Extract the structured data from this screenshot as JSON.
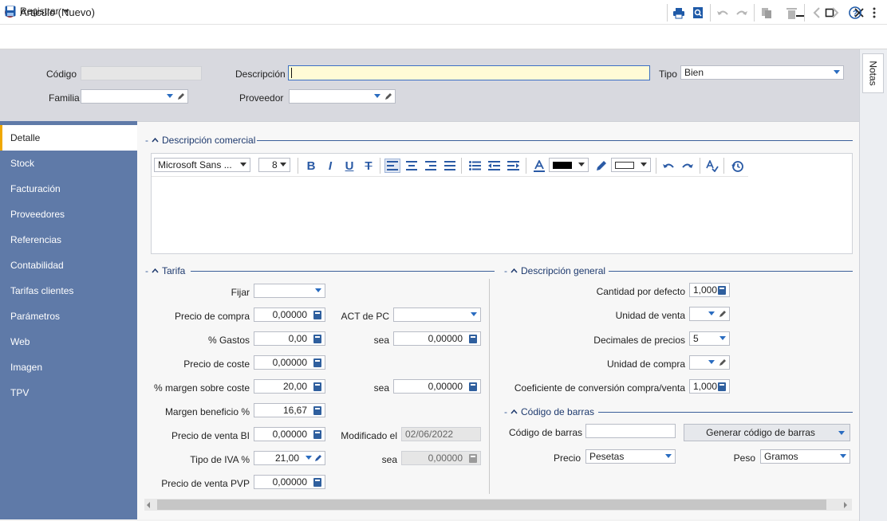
{
  "window": {
    "title": "Artículo (Nuevo)"
  },
  "toolbar": {
    "register_label": "Registrar"
  },
  "header": {
    "codigo_label": "Código",
    "codigo_value": "",
    "descripcion_label": "Descripción",
    "descripcion_value": "",
    "tipo_label": "Tipo",
    "tipo_value": "Bien",
    "familia_label": "Familia",
    "familia_value": "",
    "proveedor_label": "Proveedor",
    "proveedor_value": ""
  },
  "notes_tab": "Notas",
  "nav": {
    "items": [
      "Detalle",
      "Stock",
      "Facturación",
      "Proveedores",
      "Referencias",
      "Contabilidad",
      "Tarifas clientes",
      "Parámetros",
      "Web",
      "Imagen",
      "TPV"
    ]
  },
  "commercial": {
    "title": "Descripción comercial",
    "font_name": "Microsoft Sans ...",
    "font_size": "8"
  },
  "tarifa": {
    "title": "Tarifa",
    "fijar_label": "Fijar",
    "fijar_value": "",
    "precio_compra_label": "Precio de compra",
    "precio_compra_value": "0,00000",
    "gastos_label": "% Gastos",
    "gastos_value": "0,00",
    "precio_coste_label": "Precio de coste",
    "precio_coste_value": "0,00000",
    "margen_coste_label": "% margen sobre coste",
    "margen_coste_value": "20,00",
    "margen_beneficio_label": "Margen beneficio %",
    "margen_beneficio_value": "16,67",
    "precio_venta_bi_label": "Precio de venta BI",
    "precio_venta_bi_value": "0,00000",
    "tipo_iva_label": "Tipo de IVA %",
    "tipo_iva_value": "21,00",
    "precio_venta_pvp_label": "Precio de venta PVP",
    "precio_venta_pvp_value": "0,00000",
    "act_pc_label": "ACT de PC",
    "act_pc_value": "",
    "sea1_label": "sea",
    "sea1_value": "0,00000",
    "sea2_label": "sea",
    "sea2_value": "0,00000",
    "modificado_label": "Modificado el",
    "modificado_value": "02/06/2022",
    "sea3_label": "sea",
    "sea3_value": "0,00000"
  },
  "general": {
    "title": "Descripción general",
    "cantidad_label": "Cantidad por defecto",
    "cantidad_value": "1,000",
    "unidad_venta_label": "Unidad de venta",
    "unidad_venta_value": "",
    "decimales_label": "Decimales de precios",
    "decimales_value": "5",
    "unidad_compra_label": "Unidad de compra",
    "unidad_compra_value": "",
    "coeficiente_label": "Coeficiente de conversión compra/venta",
    "coeficiente_value": "1,000"
  },
  "barcode": {
    "title": "Código de barras",
    "codigo_label": "Código de barras",
    "codigo_value": "",
    "generar_label": "Generar código de barras",
    "precio_label": "Precio",
    "precio_value": "Pesetas",
    "peso_label": "Peso",
    "peso_value": "Gramos"
  }
}
